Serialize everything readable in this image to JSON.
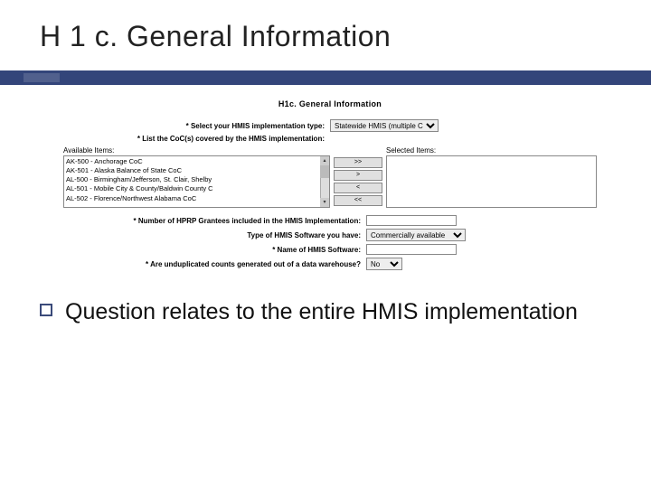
{
  "slide": {
    "title": "H 1 c. General Information",
    "bullet": "Question relates to the entire HMIS implementation"
  },
  "form": {
    "heading": "H1c. General Information",
    "impl_type_label": "* Select your HMIS implementation type:",
    "impl_type_value": "Statewide HMIS (multiple CoCs)",
    "list_coc_label": "* List the CoC(s) covered by the HMIS implementation:",
    "available_label": "Available Items:",
    "selected_label": "Selected Items:",
    "available_items": [
      "AK-500 - Anchorage CoC",
      "AK-501 - Alaska Balance of State CoC",
      "AL-500 - Birmingham/Jefferson, St. Clair, Shelby",
      "AL-501 - Mobile City & County/Baldwin County C",
      "AL-502 - Florence/Northwest Alabama CoC"
    ],
    "btns": {
      "add_all": ">>",
      "add": ">",
      "remove": "<",
      "remove_all": "<<"
    },
    "grantees_label": "* Number of HPRP Grantees included in the HMIS Implementation:",
    "grantees_value": "",
    "soft_type_label": "Type of HMIS Software you have:",
    "soft_type_value": "Commercially available",
    "soft_name_label": "* Name of HMIS Software:",
    "soft_name_value": "",
    "warehouse_label": "* Are unduplicated counts generated out of a data warehouse?",
    "warehouse_value": "No"
  }
}
